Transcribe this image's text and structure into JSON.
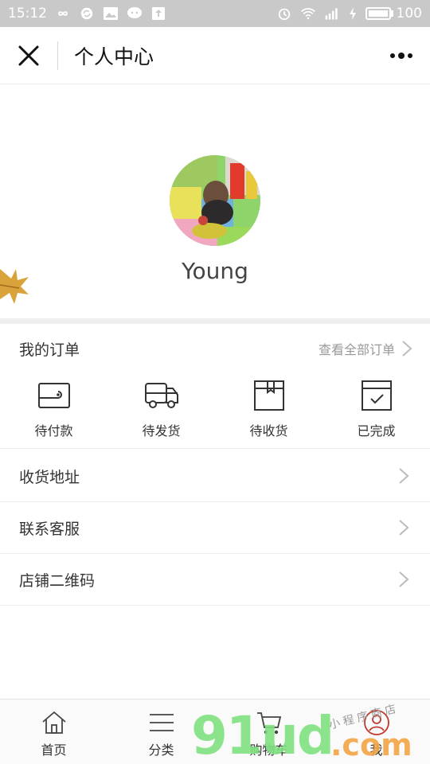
{
  "status_bar": {
    "time": "15:12",
    "battery": "100"
  },
  "nav": {
    "title": "个人中心"
  },
  "profile": {
    "username": "Young"
  },
  "orders": {
    "title": "我的订单",
    "view_all": "查看全部订单",
    "items": [
      {
        "label": "待付款",
        "icon": "wallet-icon"
      },
      {
        "label": "待发货",
        "icon": "truck-icon"
      },
      {
        "label": "待收货",
        "icon": "box-icon"
      },
      {
        "label": "已完成",
        "icon": "check-box-icon"
      }
    ]
  },
  "menu": [
    {
      "label": "收货地址"
    },
    {
      "label": "联系客服"
    },
    {
      "label": "店铺二维码"
    }
  ],
  "tabs": [
    {
      "label": "首页",
      "icon": "home-icon"
    },
    {
      "label": "分类",
      "icon": "list-icon"
    },
    {
      "label": "购物车",
      "icon": "cart-icon"
    },
    {
      "label": "我",
      "icon": "user-icon"
    }
  ],
  "watermark": {
    "main": "91ud",
    "domain": ".com",
    "tagline": "小程序商店"
  },
  "colors": {
    "status_bar": "#c9c9c9",
    "divider": "#efefef",
    "watermark_green": "#7fe27f",
    "watermark_orange": "#f4a546"
  }
}
